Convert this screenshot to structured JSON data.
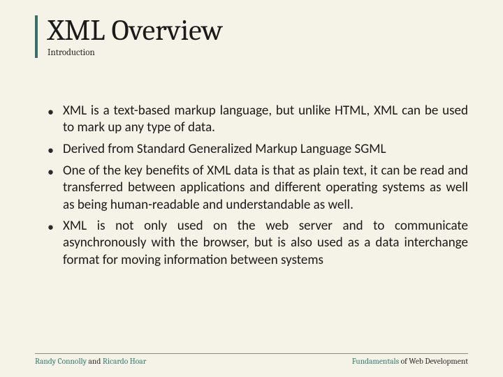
{
  "title": "XML Overview",
  "subtitle": "Introduction",
  "bullets": [
    "XML is a text-based markup language, but unlike HTML, XML can be used to mark up any type of data.",
    "Derived from Standard Generalized Markup Language SGML",
    "One of the key benefits of XML data is that as plain text, it can be read and transferred between applications and different operating systems as well as being human-readable and understandable as well.",
    "XML is not only used on the web server and to communicate asynchronously with the browser, but is also used as a data interchange format for moving information between systems"
  ],
  "footer": {
    "left_a": "Randy Connolly",
    "left_mid": " and ",
    "left_b": "Ricardo Hoar",
    "right_a": "Fundamentals",
    "right_b": " of Web Development"
  }
}
